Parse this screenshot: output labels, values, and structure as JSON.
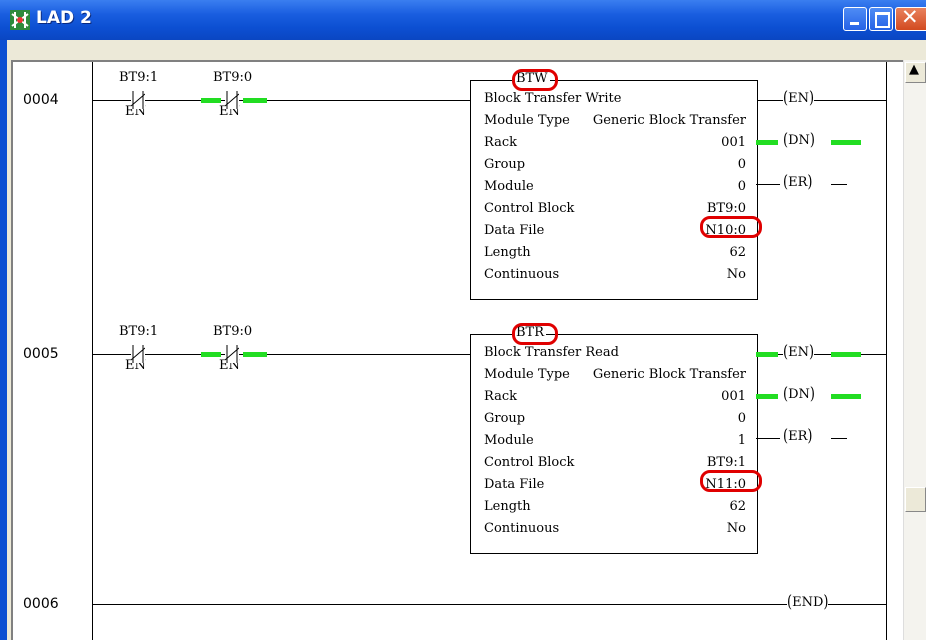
{
  "window": {
    "title": "LAD 2"
  },
  "colors": {
    "energized": "#22dd22",
    "highlight": "#e00000",
    "titlebar": "#0c4fd2"
  },
  "icons": {
    "app": "ladder-logic-icon",
    "minimize": "minimize-icon",
    "maximize": "maximize-icon",
    "close": "close-icon",
    "scroll_up": "scroll-up-arrow-icon"
  },
  "rungs": [
    {
      "number": "0004",
      "contacts": [
        {
          "address": "BT9:1",
          "bit": "EN",
          "energized": false
        },
        {
          "address": "BT9:0",
          "bit": "EN",
          "energized": true
        }
      ],
      "instruction": {
        "mnemonic": "BTW",
        "title": "Block Transfer Write",
        "rows": [
          {
            "label": "Module Type",
            "value": "Generic Block Transfer"
          },
          {
            "label": "Rack",
            "value": "001"
          },
          {
            "label": "Group",
            "value": "0"
          },
          {
            "label": "Module",
            "value": "0"
          },
          {
            "label": "Control Block",
            "value": "BT9:0"
          },
          {
            "label": "Data File",
            "value": "N10:0"
          },
          {
            "label": "Length",
            "value": "62"
          },
          {
            "label": "Continuous",
            "value": "No"
          }
        ]
      },
      "outputs": [
        {
          "label": "EN",
          "energized": false
        },
        {
          "label": "DN",
          "energized": true
        },
        {
          "label": "ER",
          "energized": false
        }
      ]
    },
    {
      "number": "0005",
      "contacts": [
        {
          "address": "BT9:1",
          "bit": "EN",
          "energized": false
        },
        {
          "address": "BT9:0",
          "bit": "EN",
          "energized": true
        }
      ],
      "instruction": {
        "mnemonic": "BTR",
        "title": "Block Transfer Read",
        "rows": [
          {
            "label": "Module Type",
            "value": "Generic Block Transfer"
          },
          {
            "label": "Rack",
            "value": "001"
          },
          {
            "label": "Group",
            "value": "0"
          },
          {
            "label": "Module",
            "value": "1"
          },
          {
            "label": "Control Block",
            "value": "BT9:1"
          },
          {
            "label": "Data File",
            "value": "N11:0"
          },
          {
            "label": "Length",
            "value": "62"
          },
          {
            "label": "Continuous",
            "value": "No"
          }
        ]
      },
      "outputs": [
        {
          "label": "EN",
          "energized": true
        },
        {
          "label": "DN",
          "energized": true
        },
        {
          "label": "ER",
          "energized": false
        }
      ]
    },
    {
      "number": "0006",
      "output": {
        "label": "END"
      }
    }
  ]
}
